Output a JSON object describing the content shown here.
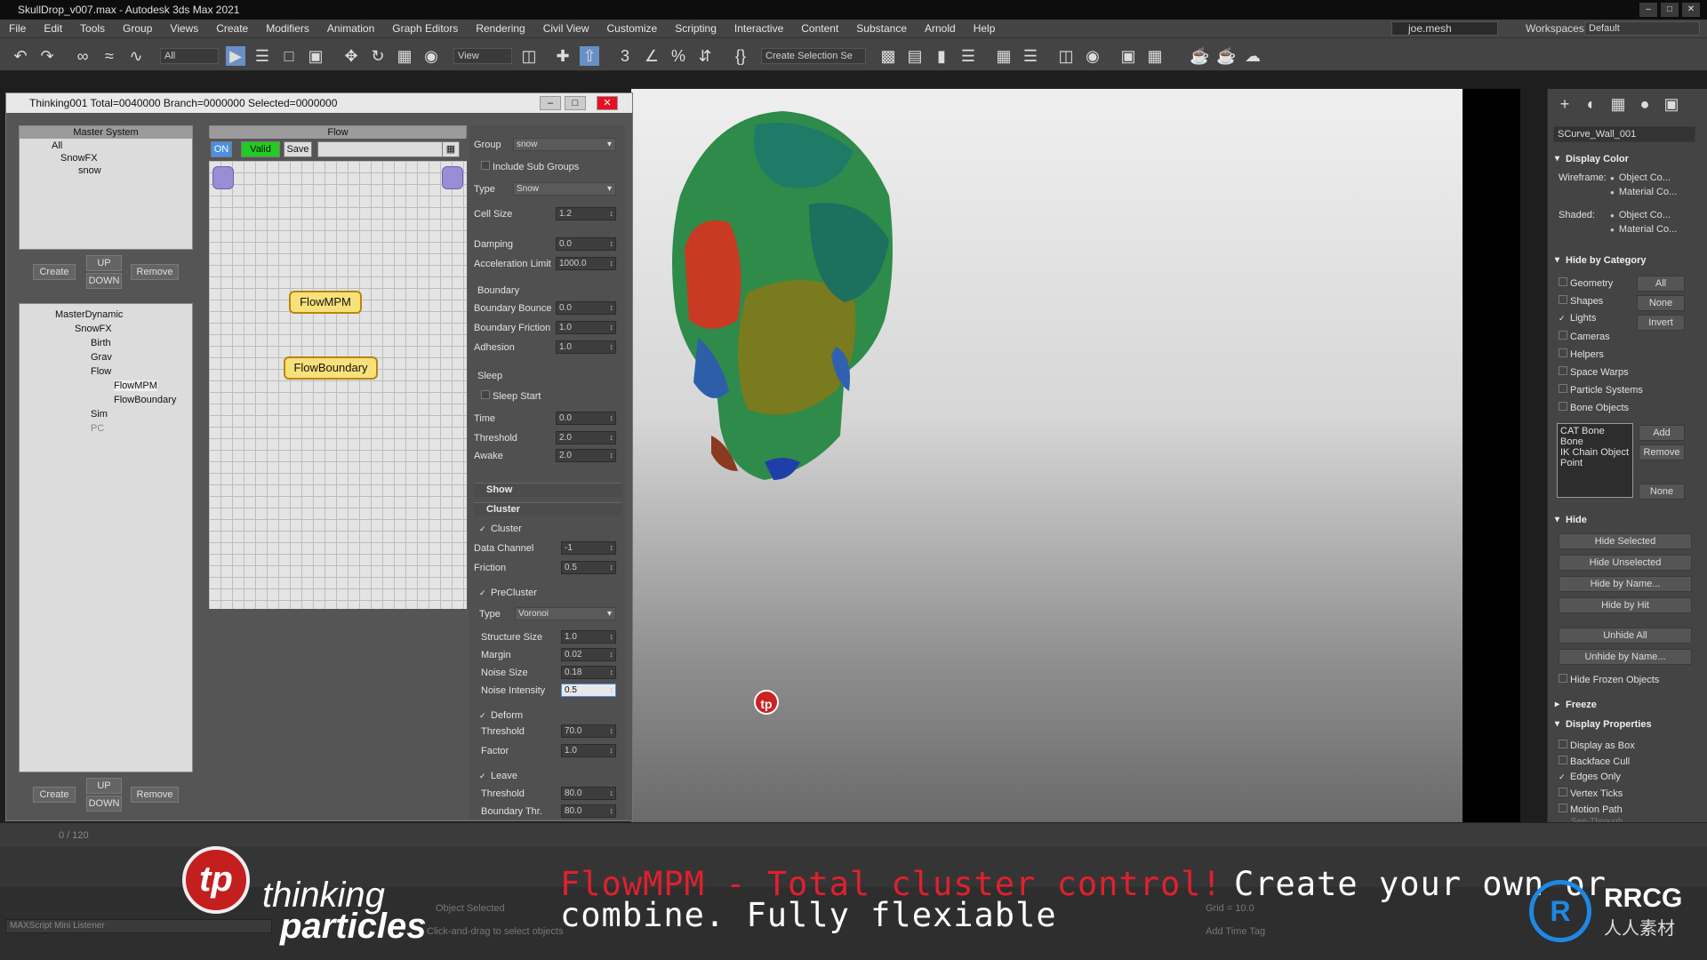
{
  "window": {
    "title": "SkullDrop_v007.max - Autodesk 3ds Max 2021"
  },
  "menu": [
    "File",
    "Edit",
    "Tools",
    "Group",
    "Views",
    "Create",
    "Modifiers",
    "Animation",
    "Graph Editors",
    "Rendering",
    "Civil View",
    "Customize",
    "Scripting",
    "Interactive",
    "Content",
    "Substance",
    "Arnold",
    "Help"
  ],
  "user": "joe.mesh",
  "workspaces": {
    "label": "Workspaces:",
    "value": "Default"
  },
  "toolbar": {
    "filter": "All",
    "view": "View",
    "selection_set": "Create Selection Se"
  },
  "thinking": {
    "title": "Thinking001  Total=0040000  Branch=0000000  Selected=0000000",
    "master_system": {
      "header": "Master System",
      "tree": [
        "All",
        "SnowFX",
        "snow"
      ],
      "buttons": {
        "create": "Create",
        "up": "UP",
        "down": "DOWN",
        "remove": "Remove"
      }
    },
    "master_dynamic": {
      "tree": [
        "MasterDynamic",
        "SnowFX",
        "Birth",
        "Grav",
        "Flow",
        "FlowMPM",
        "FlowBoundary",
        "Sim",
        "PC"
      ],
      "buttons": {
        "create": "Create",
        "up": "UP",
        "down": "DOWN",
        "remove": "Remove"
      }
    },
    "flow": {
      "header": "Flow",
      "on": "ON",
      "valid": "Valid",
      "save": "Save",
      "nodes": [
        "FlowMPM",
        "FlowBoundary"
      ]
    },
    "params": {
      "group_label": "Group",
      "group_value": "snow",
      "include_sub_groups": "Include Sub Groups",
      "type_label": "Type",
      "type_value": "Snow",
      "cell_size_label": "Cell Size",
      "cell_size": "1.2",
      "damping_label": "Damping",
      "damping": "0.0",
      "accel_label": "Acceleration Limit",
      "accel": "1000.0",
      "boundary_header": "Boundary",
      "bbounce_label": "Boundary Bounce",
      "bbounce": "0.0",
      "bfriction_label": "Boundary Friction",
      "bfriction": "1.0",
      "adhesion_label": "Adhesion",
      "adhesion": "1.0",
      "sleep_header": "Sleep",
      "sleep_start": "Sleep Start",
      "time_label": "Time",
      "time": "0.0",
      "threshold_label": "Threshold",
      "threshold": "2.0",
      "awake_label": "Awake",
      "awake": "2.0",
      "show_rollout": "Show",
      "cluster_rollout": "Cluster",
      "cluster_chk": "Cluster",
      "data_channel_label": "Data Channel",
      "data_channel": "-1",
      "friction_label": "Friction",
      "friction": "0.5",
      "precluster": "PreCluster",
      "pc_type_label": "Type",
      "pc_type": "Voronoi",
      "structure_size_label": "Structure Size",
      "structure_size": "1.0",
      "margin_label": "Margin",
      "margin": "0.02",
      "noise_size_label": "Noise Size",
      "noise_size": "0.18",
      "noise_intensity_label": "Noise Intensity",
      "noise_intensity": "0.5",
      "deform": "Deform",
      "d_threshold_label": "Threshold",
      "d_threshold": "70.0",
      "factor_label": "Factor",
      "factor": "1.0",
      "leave": "Leave",
      "l_threshold_label": "Threshold",
      "l_threshold": "80.0",
      "boundary_thr_label": "Boundary Thr.",
      "boundary_thr": "80.0"
    }
  },
  "command_panel": {
    "object_name": "SCurve_Wall_001",
    "display_color": "Display Color",
    "wireframe": "Wireframe:",
    "shaded": "Shaded:",
    "object_color": "Object Co...",
    "material_color": "Material Co...",
    "hide_by_category": "Hide by Category",
    "categories": [
      "Geometry",
      "Shapes",
      "Lights",
      "Cameras",
      "Helpers",
      "Space Warps",
      "Particle Systems",
      "Bone Objects"
    ],
    "cat_buttons": {
      "all": "All",
      "none": "None",
      "invert": "Invert",
      "add": "Add",
      "remove": "Remove",
      "none2": "None"
    },
    "bone_list": [
      "CAT Bone",
      "Bone",
      "IK Chain Object",
      "Point"
    ],
    "hide": "Hide",
    "hide_buttons": [
      "Hide Selected",
      "Hide Unselected",
      "Hide by Name...",
      "Hide by Hit",
      "Unhide All",
      "Unhide by Name..."
    ],
    "hide_frozen": "Hide Frozen Objects",
    "freeze": "Freeze",
    "display_properties": "Display Properties",
    "display_opts": [
      "Display as Box",
      "Backface Cull",
      "Edges Only",
      "Vertex Ticks",
      "Motion Path"
    ],
    "see_through": "See-Through"
  },
  "timeline": {
    "frame": "0 / 120"
  },
  "status": {
    "selected": "Object Selected",
    "hint": "Click-and-drag to select objects",
    "grid": "Grid = 10.0",
    "add_time_tag": "Add Time Tag",
    "listener": "MAXScript Mini Listener"
  },
  "caption": {
    "red": "FlowMPM - Total cluster control!",
    "white1": "Create your own or",
    "white2": "combine.  Fully flexiable"
  },
  "logo": {
    "tp": "tp",
    "line1": "thinking",
    "line2": "particles"
  },
  "watermark": {
    "title": "RRCG",
    "subtitle": "人人素材"
  },
  "viewport_mark": "tp"
}
